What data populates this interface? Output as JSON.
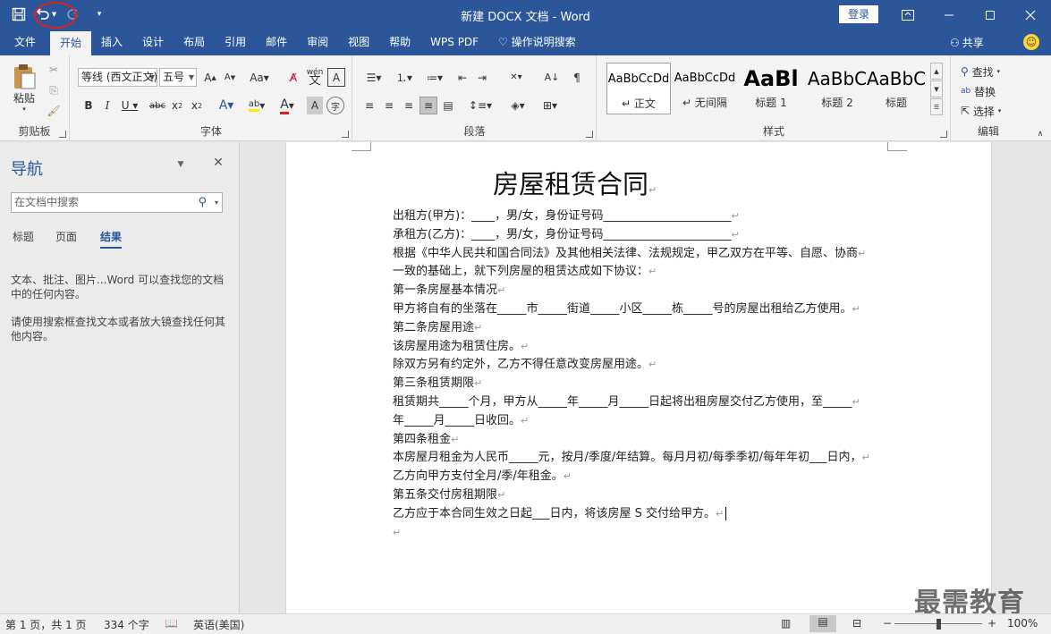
{
  "app": {
    "title": "新建 DOCX 文档  -  Word",
    "login_label": "登录",
    "share_label": "共享"
  },
  "tabs": [
    "文件",
    "开始",
    "插入",
    "设计",
    "布局",
    "引用",
    "邮件",
    "审阅",
    "视图",
    "帮助",
    "WPS PDF"
  ],
  "tell_me": "操作说明搜索",
  "ribbon": {
    "clipboard": {
      "paste": "粘贴",
      "label": "剪贴板"
    },
    "font": {
      "name": "等线 (西文正文)",
      "size": "五号",
      "label": "字体"
    },
    "paragraph": {
      "label": "段落"
    },
    "styles": {
      "label": "样式",
      "items": [
        {
          "preview": "AaBbCcDd",
          "name": "正文"
        },
        {
          "preview": "AaBbCcDd",
          "name": "无间隔"
        },
        {
          "preview": "AaBl",
          "name": "标题 1"
        },
        {
          "preview": "AaBbC",
          "name": "标题 2"
        },
        {
          "preview": "AaBbC",
          "name": "标题"
        }
      ]
    },
    "editing": {
      "find": "查找",
      "replace": "替换",
      "select": "选择",
      "label": "编辑"
    }
  },
  "nav": {
    "title": "导航",
    "search_placeholder": "在文档中搜索",
    "tabs": [
      "标题",
      "页面",
      "结果"
    ],
    "text1": "文本、批注、图片...Word 可以查找您的文档中的任何内容。",
    "text2": "请使用搜索框查找文本或者放大镜查找任何其他内容。"
  },
  "document": {
    "title": "房屋租赁合同",
    "lines": [
      "出租方(甲方)：____，男/女，身份证号码______________________",
      "承租方(乙方)：____，男/女，身份证号码______________________",
      "根据《中华人民共和国合同法》及其他相关法律、法规规定，甲乙双方在平等、自愿、协商",
      "一致的基础上，就下列房屋的租赁达成如下协议：",
      "第一条房屋基本情况",
      "甲方将自有的坐落在_____市_____街道_____小区_____栋_____号的房屋出租给乙方使用。",
      "第二条房屋用途",
      "该房屋用途为租赁住房。",
      "除双方另有约定外，乙方不得任意改变房屋用途。",
      "第三条租赁期限",
      "租赁期共_____个月，甲方从_____年_____月_____日起将出租房屋交付乙方使用，至_____",
      "年_____月_____日收回。",
      "第四条租金",
      "本房屋月租金为人民币_____元，按月/季度/年结算。每月月初/每季季初/每年年初___日内，",
      "乙方向甲方支付全月/季/年租金。",
      "第五条交付房租期限",
      "乙方应于本合同生效之日起___日内，将该房屋 S 交付给甲方。",
      ""
    ]
  },
  "status": {
    "page": "第 1 页，共 1 页",
    "words": "334 个字",
    "language": "英语(美国)",
    "zoom": "100%"
  },
  "watermark": "最需教育",
  "colors": {
    "brand": "#2b579a",
    "annotation": "#e02020"
  }
}
